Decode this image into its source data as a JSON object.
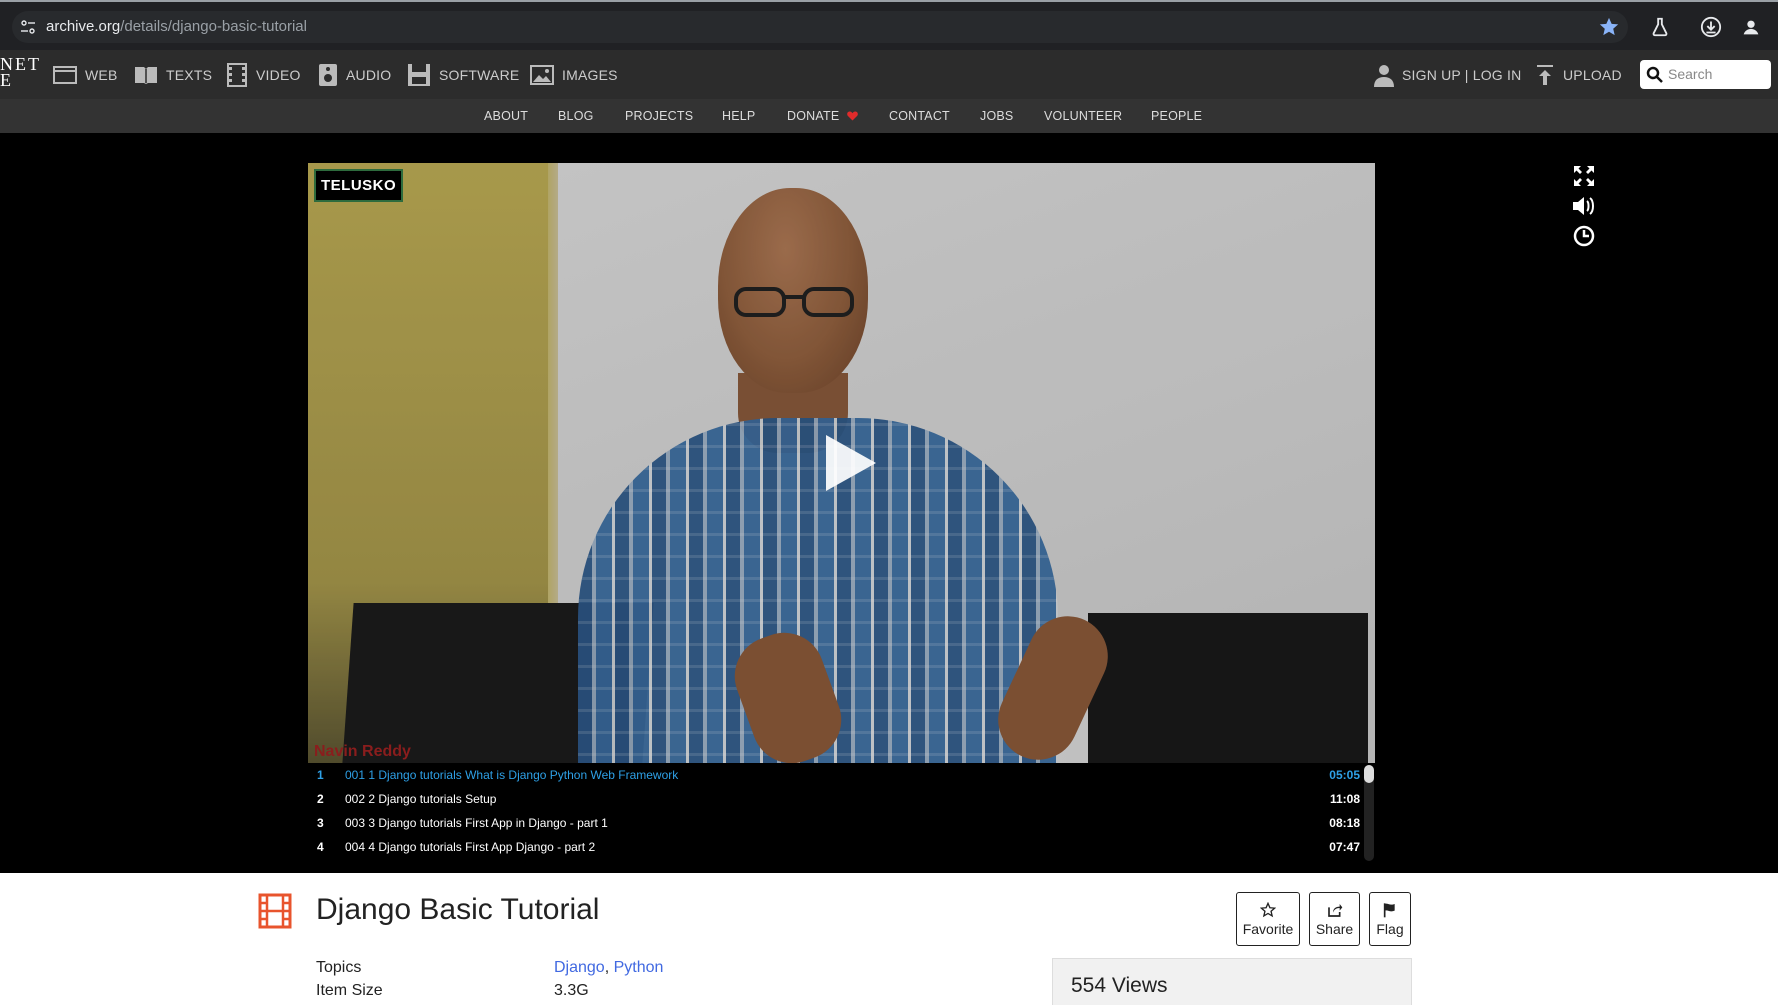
{
  "browser": {
    "url_host": "archive.org",
    "url_path": "/details/django-basic-tutorial"
  },
  "ia_nav": {
    "logo_fragment_line1": "NET",
    "logo_fragment_line2": "E",
    "items": [
      {
        "label": "WEB",
        "icon": "web-icon"
      },
      {
        "label": "TEXTS",
        "icon": "texts-icon"
      },
      {
        "label": "VIDEO",
        "icon": "video-icon"
      },
      {
        "label": "AUDIO",
        "icon": "audio-icon"
      },
      {
        "label": "SOFTWARE",
        "icon": "software-icon"
      },
      {
        "label": "IMAGES",
        "icon": "images-icon"
      }
    ],
    "signup_login": "SIGN UP | LOG IN",
    "upload": "UPLOAD",
    "search_placeholder": "Search"
  },
  "sub_nav": {
    "items": [
      "ABOUT",
      "BLOG",
      "PROJECTS",
      "HELP",
      "DONATE",
      "CONTACT",
      "JOBS",
      "VOLUNTEER",
      "PEOPLE"
    ],
    "donate_heart_color": "#e02b2b"
  },
  "video": {
    "channel_badge": "TELUSKO",
    "watermark": "Navin Reddy"
  },
  "playlist": [
    {
      "num": "1",
      "title": "001 1 Django tutorials What is Django Python Web Framework",
      "duration": "05:05",
      "active": true
    },
    {
      "num": "2",
      "title": "002 2 Django tutorials Setup",
      "duration": "11:08",
      "active": false
    },
    {
      "num": "3",
      "title": "003 3 Django tutorials First App in Django - part 1",
      "duration": "08:18",
      "active": false
    },
    {
      "num": "4",
      "title": "004 4 Django tutorials First App Django - part 2",
      "duration": "07:47",
      "active": false
    }
  ],
  "item": {
    "title": "Django Basic Tutorial",
    "actions": {
      "favorite": "Favorite",
      "share": "Share",
      "flag": "Flag"
    },
    "topics_label": "Topics",
    "topics": [
      "Django",
      "Python"
    ],
    "topics_sep": ", ",
    "size_label": "Item Size",
    "size_value": "3.3G",
    "views": "554 Views"
  },
  "colors": {
    "accent_link": "#4169e1",
    "playlist_active": "#2ea0e6",
    "film_icon": "#e8542d"
  }
}
